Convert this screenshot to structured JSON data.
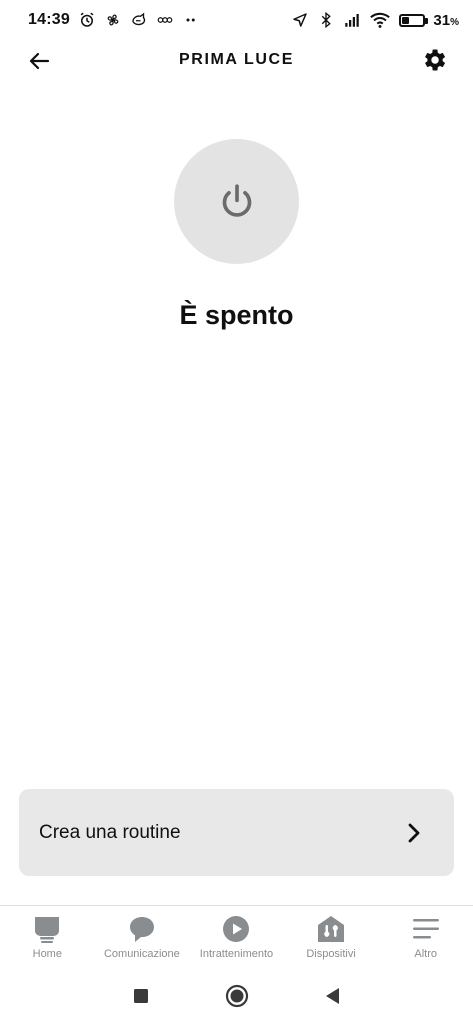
{
  "status_bar": {
    "time": "14:39",
    "battery_text": "31",
    "battery_unit": "%",
    "battery_level": 0.31,
    "left_icons": [
      "alarm-icon",
      "fan-icon",
      "chat-icon",
      "bubble-icon",
      "more-dots-icon"
    ],
    "right_icons": [
      "location-arrow-icon",
      "bluetooth-icon",
      "signal-icon",
      "wifi-icon",
      "battery-icon"
    ]
  },
  "header": {
    "title": "PRIMA LUCE",
    "back_icon": "back-arrow-icon",
    "settings_icon": "gear-icon"
  },
  "device": {
    "state_text": "È spento",
    "power_icon": "power-icon"
  },
  "routine": {
    "label": "Crea una routine",
    "icon": "chevron-right-icon"
  },
  "bottom_nav": {
    "items": [
      {
        "label": "Home",
        "icon": "home-icon"
      },
      {
        "label": "Comunicazione",
        "icon": "speech-bubble-icon"
      },
      {
        "label": "Intrattenimento",
        "icon": "play-icon"
      },
      {
        "label": "Dispositivi",
        "icon": "devices-icon"
      },
      {
        "label": "Altro",
        "icon": "menu-icon"
      }
    ]
  },
  "colors": {
    "text_primary": "#0f1111",
    "nav_gray": "#8a8d8f",
    "power_bg": "#e3e3e3",
    "card_bg": "#e8e8e8"
  }
}
